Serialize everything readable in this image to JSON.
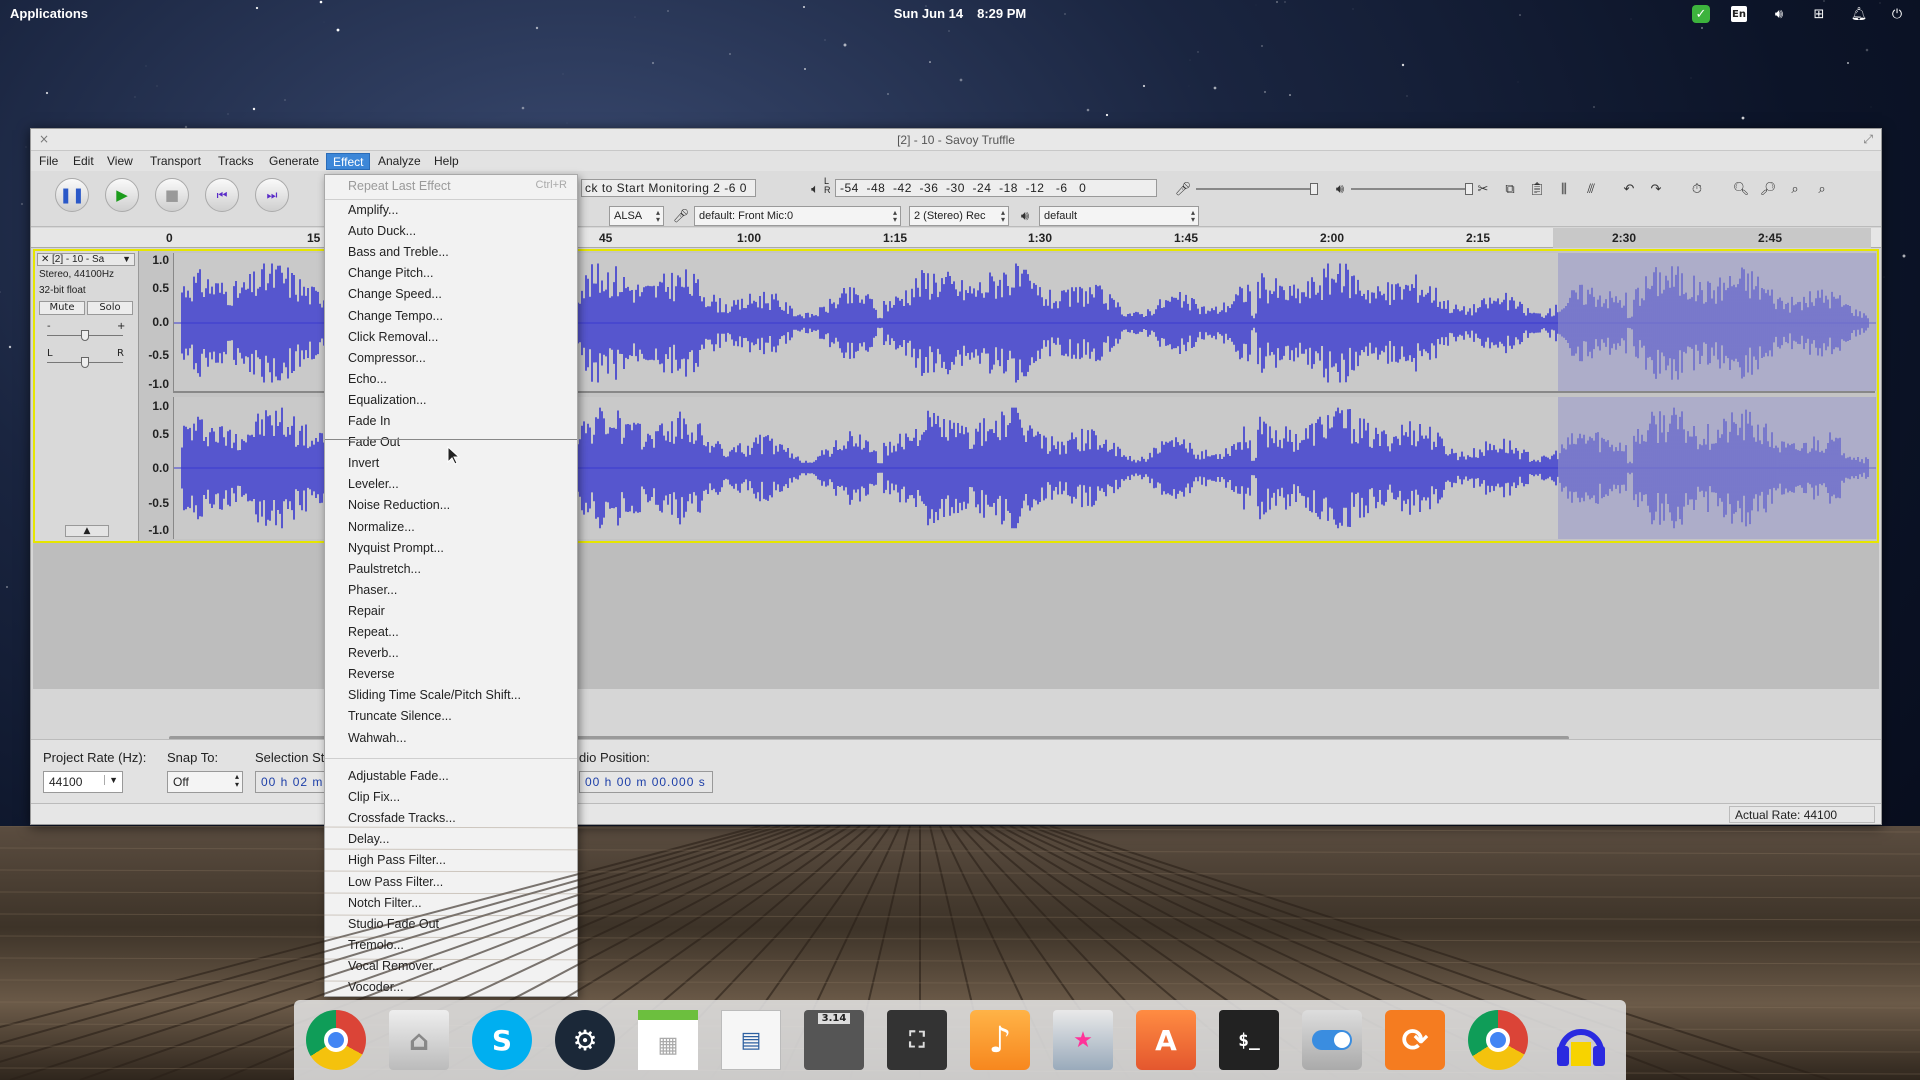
{
  "panel": {
    "applications": "Applications",
    "date": "Sun Jun 14",
    "time": "8:29 PM",
    "indicators": [
      "check-shield-icon",
      "keyboard-layout-icon",
      "volume-icon",
      "network-icon",
      "notifications-icon",
      "power-icon"
    ],
    "keyboard_layout": "En"
  },
  "window": {
    "title": "[2] - 10 - Savoy Truffle",
    "close": "×",
    "maximize": "⤢"
  },
  "menubar": [
    "File",
    "Edit",
    "View",
    "Transport",
    "Tracks",
    "Generate",
    "Effect",
    "Analyze",
    "Help"
  ],
  "active_menu": "Effect",
  "toolbar": {
    "monitor_text": "ck to Start Monitoring",
    "record_meter_ticks": "2   -6   0",
    "playback_meter_ticks": "-54  -48  -42  -36  -30  -24  -18  -12   -6   0",
    "meter_lr": "L\nR",
    "host": "ALSA",
    "input_device": "default: Front Mic:0",
    "channels": "2 (Stereo) Rec",
    "output_device": "default"
  },
  "ruler": {
    "ticks": [
      "0",
      "15",
      "45",
      "1:00",
      "1:15",
      "1:30",
      "1:45",
      "2:00",
      "2:15",
      "2:30",
      "2:45"
    ]
  },
  "track": {
    "name": "[2] - 10 - Sa",
    "info1": "Stereo, 44100Hz",
    "info2": "32-bit float",
    "mute": "Mute",
    "solo": "Solo",
    "gain_minus": "-",
    "gain_plus": "+",
    "pan_left": "L",
    "pan_right": "R",
    "scale": [
      "1.0",
      "0.5",
      "0.0",
      "-0.5",
      "-1.0"
    ],
    "wave_color": "#3a3ad0",
    "selection_color": "#9696c8"
  },
  "selection_bar": {
    "project_rate_label": "Project Rate (Hz):",
    "project_rate": "44100",
    "snap_label": "Snap To:",
    "snap_value": "Off",
    "selection_start_label": "Selection St",
    "selection_start": "00 h 02 m",
    "audio_position_label": "dio Position:",
    "audio_position": "00 h 00 m 00.000 s"
  },
  "status": {
    "actual_rate": "Actual Rate: 44100"
  },
  "effect_menu": {
    "repeat_last": "Repeat Last Effect",
    "repeat_shortcut": "Ctrl+R",
    "group1": [
      "Amplify...",
      "Auto Duck...",
      "Bass and Treble...",
      "Change Pitch...",
      "Change Speed...",
      "Change Tempo...",
      "Click Removal...",
      "Compressor...",
      "Echo...",
      "Equalization...",
      "Fade In",
      "Fade Out",
      "Invert",
      "Leveler...",
      "Noise Reduction...",
      "Normalize...",
      "Nyquist Prompt...",
      "Paulstretch...",
      "Phaser...",
      "Repair",
      "Repeat...",
      "Reverb...",
      "Reverse",
      "Sliding Time Scale/Pitch Shift...",
      "Truncate Silence...",
      "Wahwah..."
    ],
    "group2": [
      "Adjustable Fade...",
      "Clip Fix...",
      "Crossfade Tracks...",
      "Delay...",
      "High Pass Filter...",
      "Low Pass Filter...",
      "Notch Filter...",
      "Studio Fade Out",
      "Tremolo...",
      "Vocal Remover...",
      "Vocoder..."
    ]
  },
  "dock": {
    "apps": [
      "chrome-icon",
      "home-folder-icon",
      "skype-icon",
      "steam-icon",
      "calendar-icon",
      "document-viewer-icon",
      "calculator-icon",
      "screenshot-icon",
      "music-icon",
      "photos-icon",
      "app-center-icon",
      "terminal-icon",
      "switchboard-icon",
      "sync-icon",
      "chrome-icon",
      "headphones-icon"
    ],
    "calculator_display": "3.14",
    "terminal_prompt": "$_"
  }
}
